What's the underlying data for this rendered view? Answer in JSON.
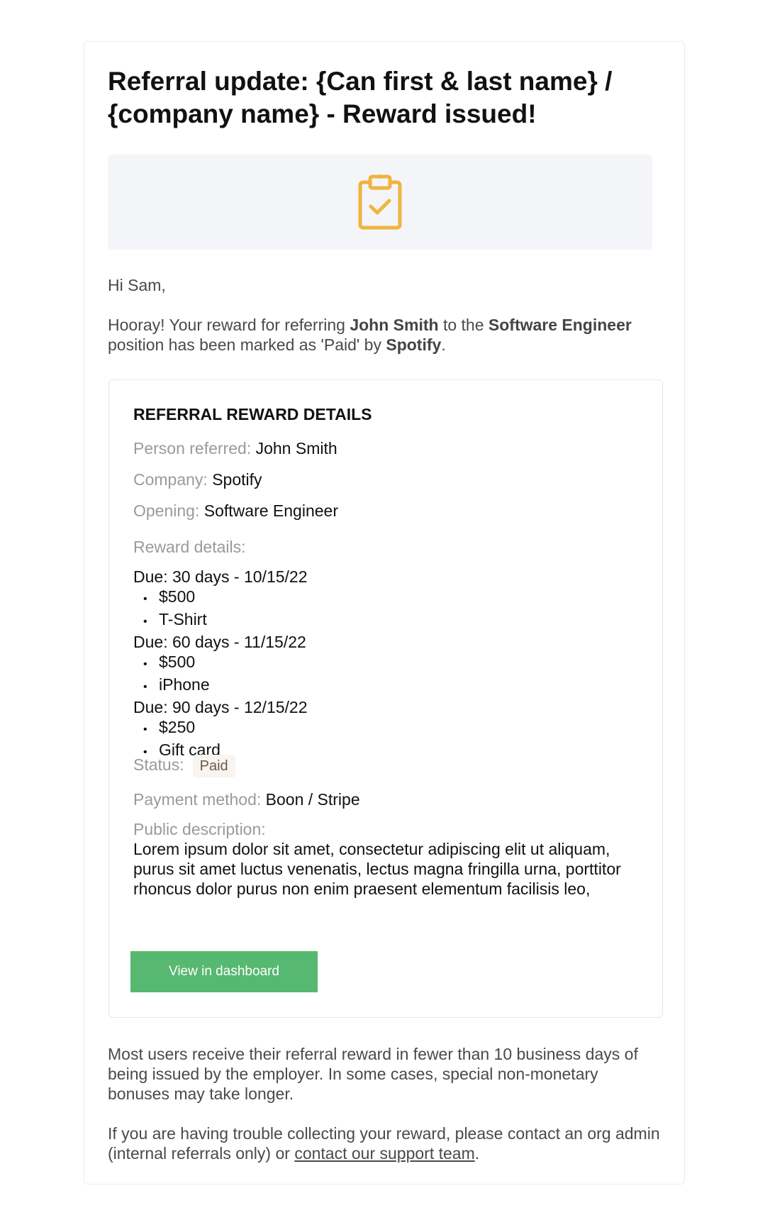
{
  "email": {
    "title": "Referral update: {Can first & last name} / {company name} - Reward issued!",
    "hero_icon": "clipboard-check-icon",
    "accent_color": "#f0b43c",
    "greeting": "Hi Sam,",
    "intro": {
      "part1": "Hooray! Your reward for referring ",
      "referred_name": "John Smith",
      "part2": " to the ",
      "position": "Software Engineer",
      "part3": " position has been marked as 'Paid' by ",
      "company": "Spotify",
      "part4": "."
    }
  },
  "details": {
    "heading": "REFERRAL REWARD DETAILS",
    "person_label": "Person referred:",
    "person_value": "John Smith",
    "company_label": "Company:",
    "company_value": "Spotify",
    "opening_label": "Opening:",
    "opening_value": "Software Engineer",
    "reward_label": "Reward details:",
    "rewards": [
      {
        "due": "Due: 30 days - 10/15/22",
        "items": [
          "$500",
          "T-Shirt"
        ]
      },
      {
        "due": "Due: 60 days - 11/15/22",
        "items": [
          "$500",
          "iPhone"
        ]
      },
      {
        "due": "Due: 90 days - 12/15/22",
        "items": [
          "$250",
          "Gift card"
        ]
      }
    ],
    "status_label": "Status:",
    "status_value": "Paid",
    "payment_label": "Payment method:",
    "payment_value": "Boon / Stripe",
    "description_label": "Public description:",
    "description_value": "Lorem ipsum dolor sit amet, consectetur adipiscing elit ut aliquam, purus sit amet luctus venenatis, lectus magna fringilla urna, porttitor rhoncus dolor purus non enim praesent elementum facilisis leo,",
    "button_label": "View in dashboard",
    "button_color": "#57b871"
  },
  "footer": {
    "note": "Most users receive their referral reward in fewer than 10 business days of being issued by the employer. In some cases, special non-monetary bonuses may take longer.",
    "help_part1": "If you are having trouble collecting your reward, please contact an org admin (internal referrals only) or ",
    "help_link": "contact our support team",
    "help_part2": "."
  }
}
